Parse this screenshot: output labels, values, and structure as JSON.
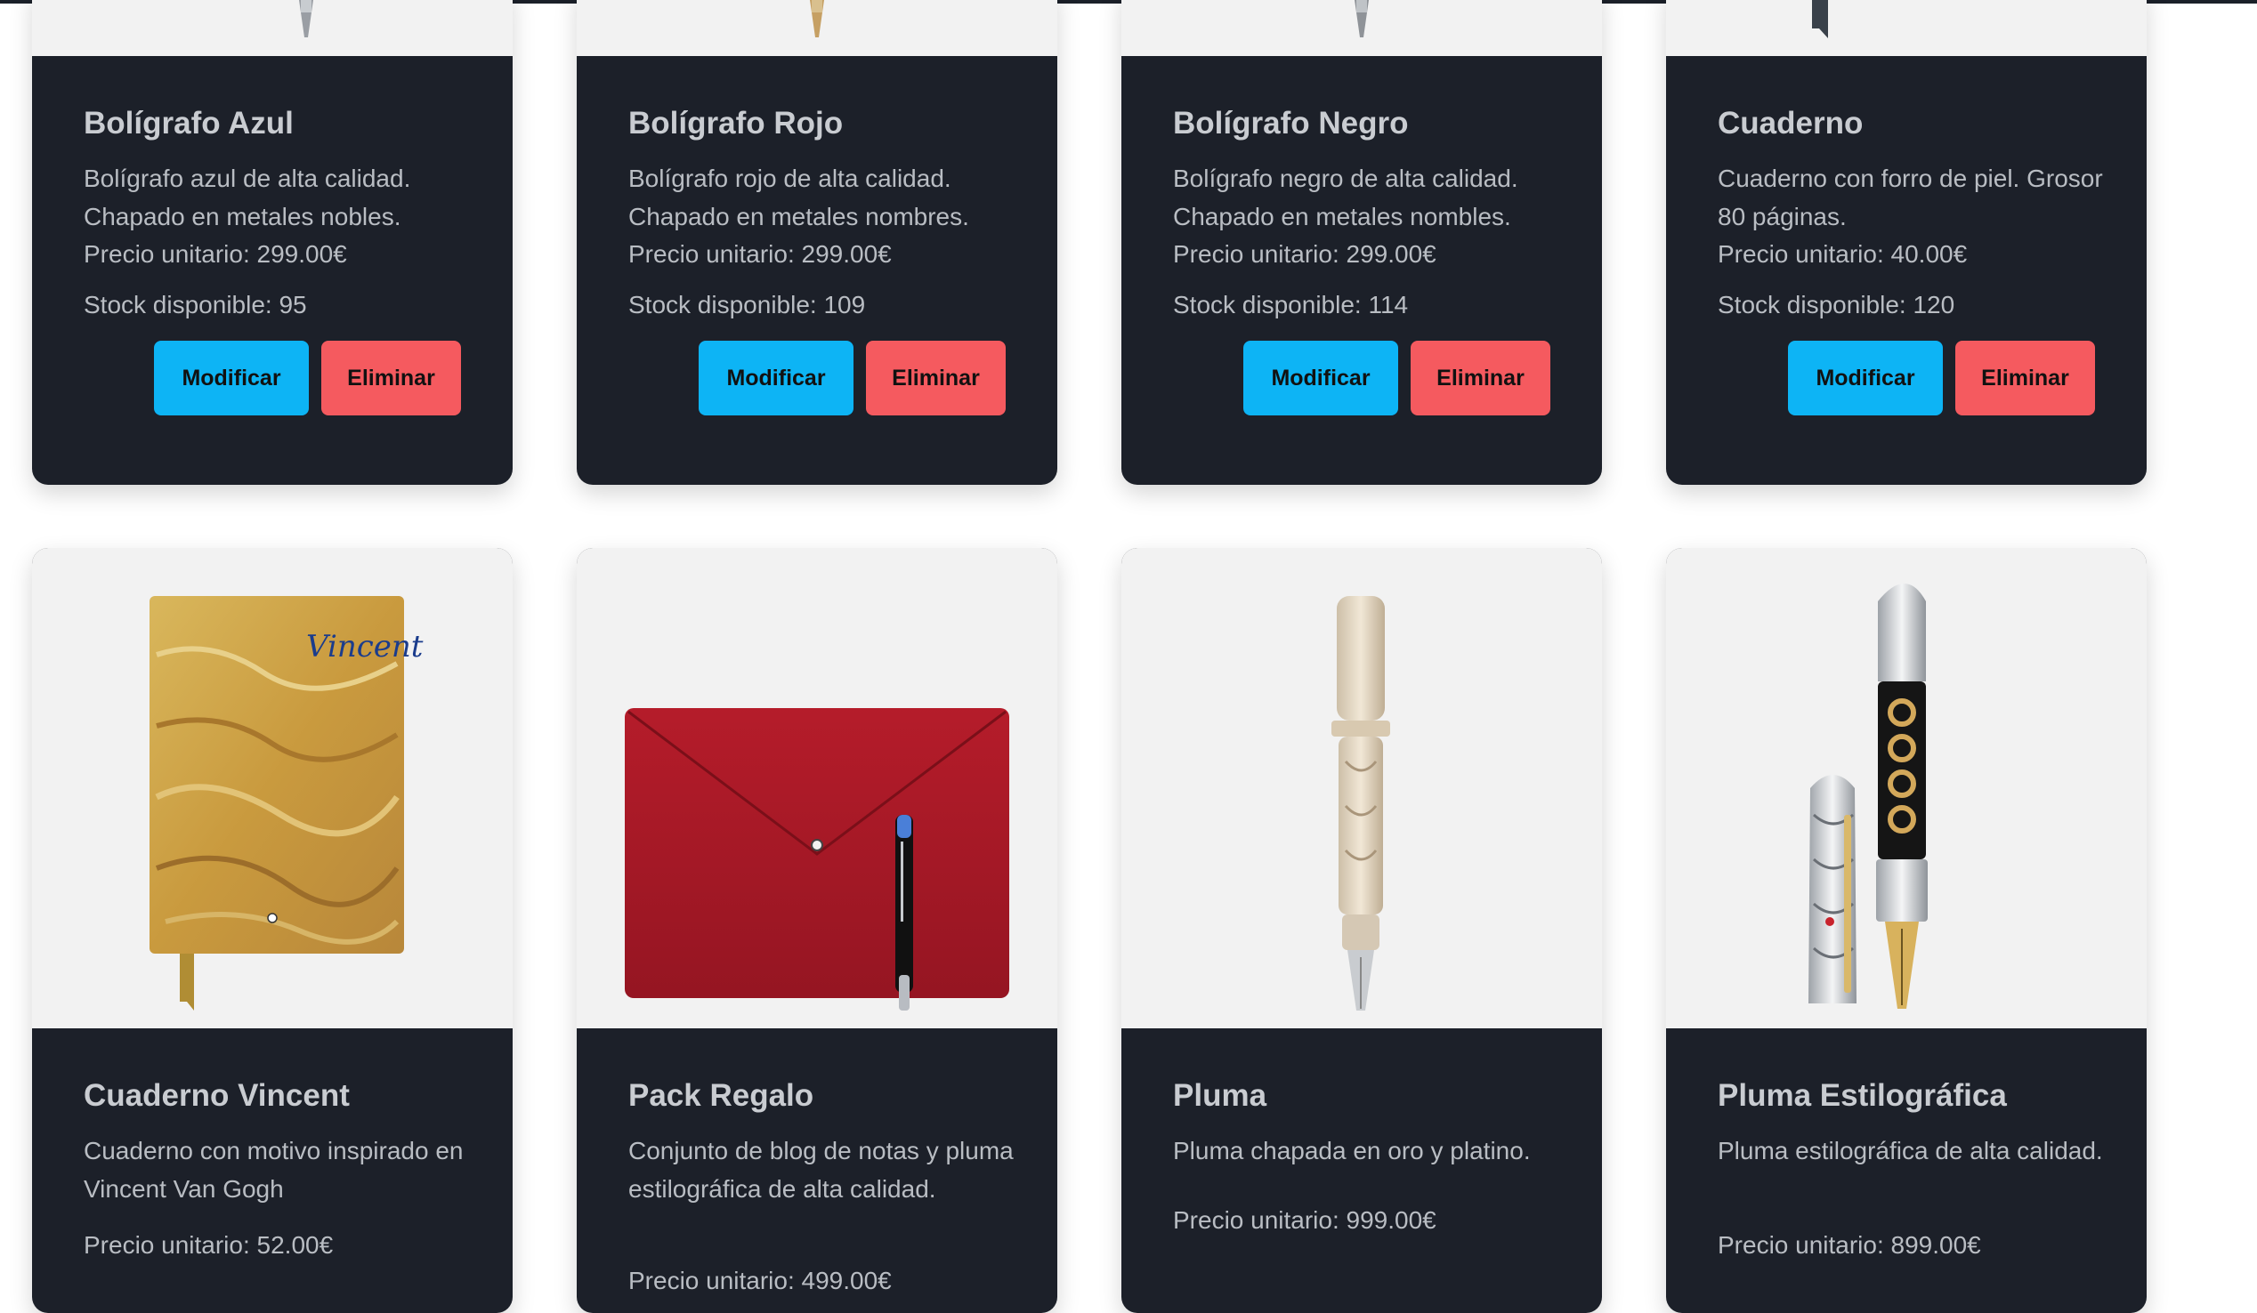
{
  "products": [
    {
      "name": "Bolígrafo Azul",
      "description": "Bolígrafo azul de alta calidad. Chapado en metales nobles.",
      "price": "Precio unitario: 299.00€",
      "stock": "Stock disponible: 95"
    },
    {
      "name": "Bolígrafo Rojo",
      "description": "Bolígrafo rojo de alta calidad. Chapado en metales nombres.",
      "price": "Precio unitario: 299.00€",
      "stock": "Stock disponible: 109"
    },
    {
      "name": "Bolígrafo Negro",
      "description": "Bolígrafo negro de alta calidad. Chapado en metales nombles.",
      "price": "Precio unitario: 299.00€",
      "stock": "Stock disponible: 114"
    },
    {
      "name": "Cuaderno",
      "description": "Cuaderno con forro de piel. Grosor 80 páginas.",
      "price": "Precio unitario: 40.00€",
      "stock": "Stock disponible: 120"
    },
    {
      "name": "Cuaderno Vincent",
      "description": "Cuaderno con motivo inspirado en Vincent Van Gogh",
      "price": "Precio unitario: 52.00€"
    },
    {
      "name": "Pack Regalo",
      "description": "Conjunto de blog de notas y pluma estilográfica de alta calidad.",
      "price": "Precio unitario: 499.00€"
    },
    {
      "name": "Pluma",
      "description": "Pluma chapada en oro y platino.",
      "price": "Precio unitario: 999.00€"
    },
    {
      "name": "Pluma Estilográfica",
      "description": "Pluma estilográfica de alta calidad.",
      "price": "Precio unitario: 899.00€"
    }
  ],
  "buttons": {
    "modify": "Modificar",
    "delete": "Eliminar"
  },
  "vincent_signature": "Vincent",
  "colors": {
    "card_background": "#1c2029",
    "image_background": "#f2f2f2",
    "modify_button": "#0db4f5",
    "delete_button": "#f55a5f"
  }
}
